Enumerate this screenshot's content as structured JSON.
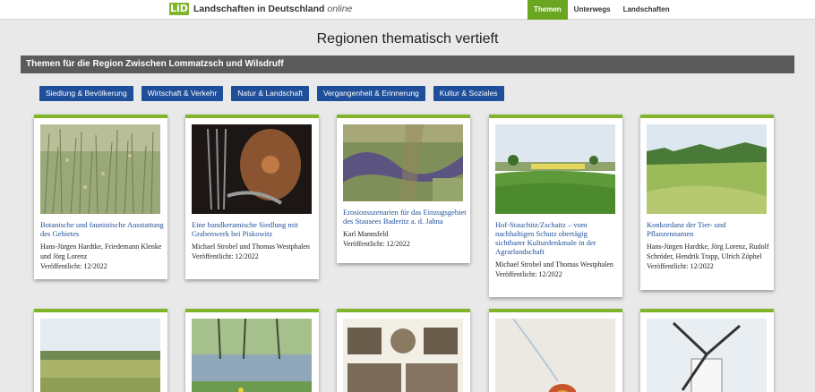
{
  "header": {
    "logo": "LiD",
    "brand_main": "Landschaften in Deutschland",
    "brand_suffix": "online",
    "nav": [
      "Themen",
      "Unterwegs",
      "Landschaften"
    ]
  },
  "page_title": "Regionen thematisch vertieft",
  "section_title": "Themen für die Region Zwischen Lommatzsch und Wilsdruff",
  "filters": [
    "Siedlung & Bevölkerung",
    "Wirtschaft & Verkehr",
    "Natur & Landschaft",
    "Vergangenheit & Erinnerung",
    "Kultur & Soziales"
  ],
  "cards": [
    {
      "title": "Botanische und faunistische Ausstattung des Gebietes",
      "authors": "Hans-Jürgen Hardtke, Friedemann Klenke und Jörg Lorenz",
      "published": "Veröffentlicht: 12/2022",
      "image_icon": "grass-field-photo"
    },
    {
      "title": "Eine bandkeramische Siedlung mit Grabenwerk bei Piskowitz",
      "authors": "Michael Strobel und Thomas Westphalen",
      "published": "Veröffentlicht: 12/2022",
      "image_icon": "tools-shield-photo"
    },
    {
      "title": "Erosionsszenarien für das Einzugsgebiet des Stausees Baderitz a. d. Jahna",
      "authors": "Karl Mannsfeld",
      "published": "Veröffentlicht: 12/2022",
      "image_icon": "aerial-reservoir-photo"
    },
    {
      "title": "Hof-Stauchitz/Zschaitz – vom nachhaltigen Schutz obertägig sichtbarer Kulturdenkmale in der Agrarlandschaft",
      "authors": "Michael Strobel und Thomas Westphalen",
      "published": "Veröffentlicht: 12/2022",
      "image_icon": "green-landscape-photo"
    },
    {
      "title": "Konkordanz der Tier- und Pflanzennamen",
      "authors": "Hans-Jürgen Hardtke, Jörg Lorenz, Rudolf Schröder, Hendrik Trapp, Ulrich Zöphel",
      "published": "Veröffentlicht: 12/2022",
      "image_icon": "meadow-photo"
    }
  ],
  "second_row_images": [
    "panorama-fields-photo",
    "pond-trees-photo",
    "old-postcard-photo",
    "artifact-photo",
    "windmill-photo"
  ]
}
